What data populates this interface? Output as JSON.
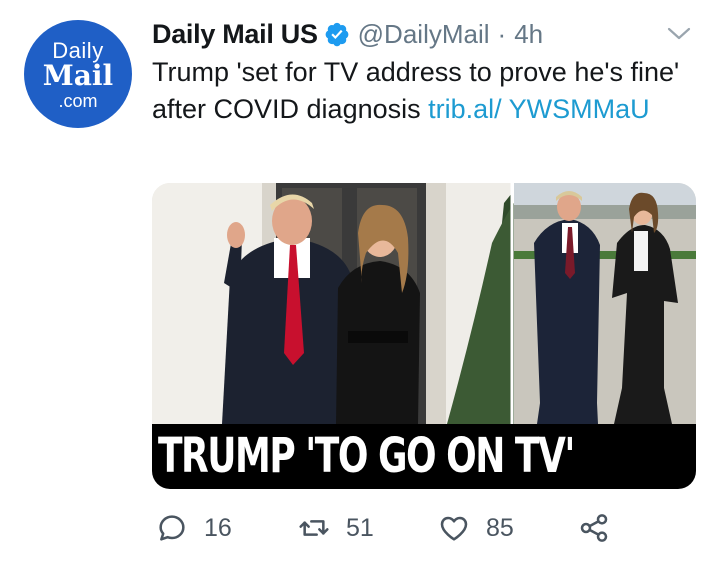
{
  "avatar": {
    "line1": "Daily",
    "line2": "Mail",
    "line3": ".com"
  },
  "tweet": {
    "display_name": "Daily Mail US",
    "handle": "@DailyMail",
    "separator": "·",
    "time": "4h",
    "text": "Trump 'set for TV address to prove he's fine' after COVID diagnosis ",
    "link": "trib.al/ YWSMMaU",
    "media_headline": "TRUMP 'TO GO ON TV'"
  },
  "actions": {
    "reply_count": "16",
    "retweet_count": "51",
    "like_count": "85"
  },
  "icons": [
    "verified-badge-icon",
    "chevron-down-icon",
    "reply-icon",
    "retweet-icon",
    "like-icon",
    "share-icon"
  ],
  "colors": {
    "accent": "#1d9bd1",
    "muted": "#657786",
    "avatar_bg": "#1f5fc6"
  }
}
